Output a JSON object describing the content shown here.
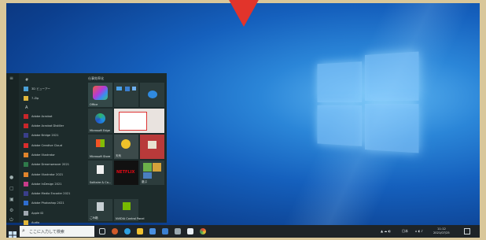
{
  "start_menu": {
    "section_hash": "#",
    "section_a": "A",
    "tiles_header": "仕事効率化",
    "apps": [
      {
        "label": "3D ビューアー"
      },
      {
        "label": "7-Zip"
      },
      {
        "label": "Adobe Acrobat"
      },
      {
        "label": "Adobe Acrobat Distiller"
      },
      {
        "label": "Adobe Bridge 2021"
      },
      {
        "label": "Adobe Creative Cloud"
      },
      {
        "label": "Adobe Illustrator"
      },
      {
        "label": "Adobe Dreamweaver 2021"
      },
      {
        "label": "Adobe Illustrator 2021"
      },
      {
        "label": "Adobe InDesign 2021"
      },
      {
        "label": "Adobe Media Encoder 2021"
      },
      {
        "label": "Adobe Photoshop 2021"
      },
      {
        "label": "Apple ID"
      },
      {
        "label": "Audio"
      }
    ],
    "tiles": {
      "office": "Office",
      "edge": "Microsoft Edge",
      "store": "Microsoft Store",
      "weather": "天気",
      "netflix": "NETFLIX",
      "solitaire": "Solitaire & Ca...",
      "games": "遊ぶ",
      "recycle": "ごみ箱",
      "nvidia": "NVIDIA Control Panel"
    }
  },
  "taskbar": {
    "search_placeholder": "ここに入力して検索",
    "tray_lang": "日本",
    "tray_time": "11:12",
    "tray_date": "2021/07/25"
  }
}
